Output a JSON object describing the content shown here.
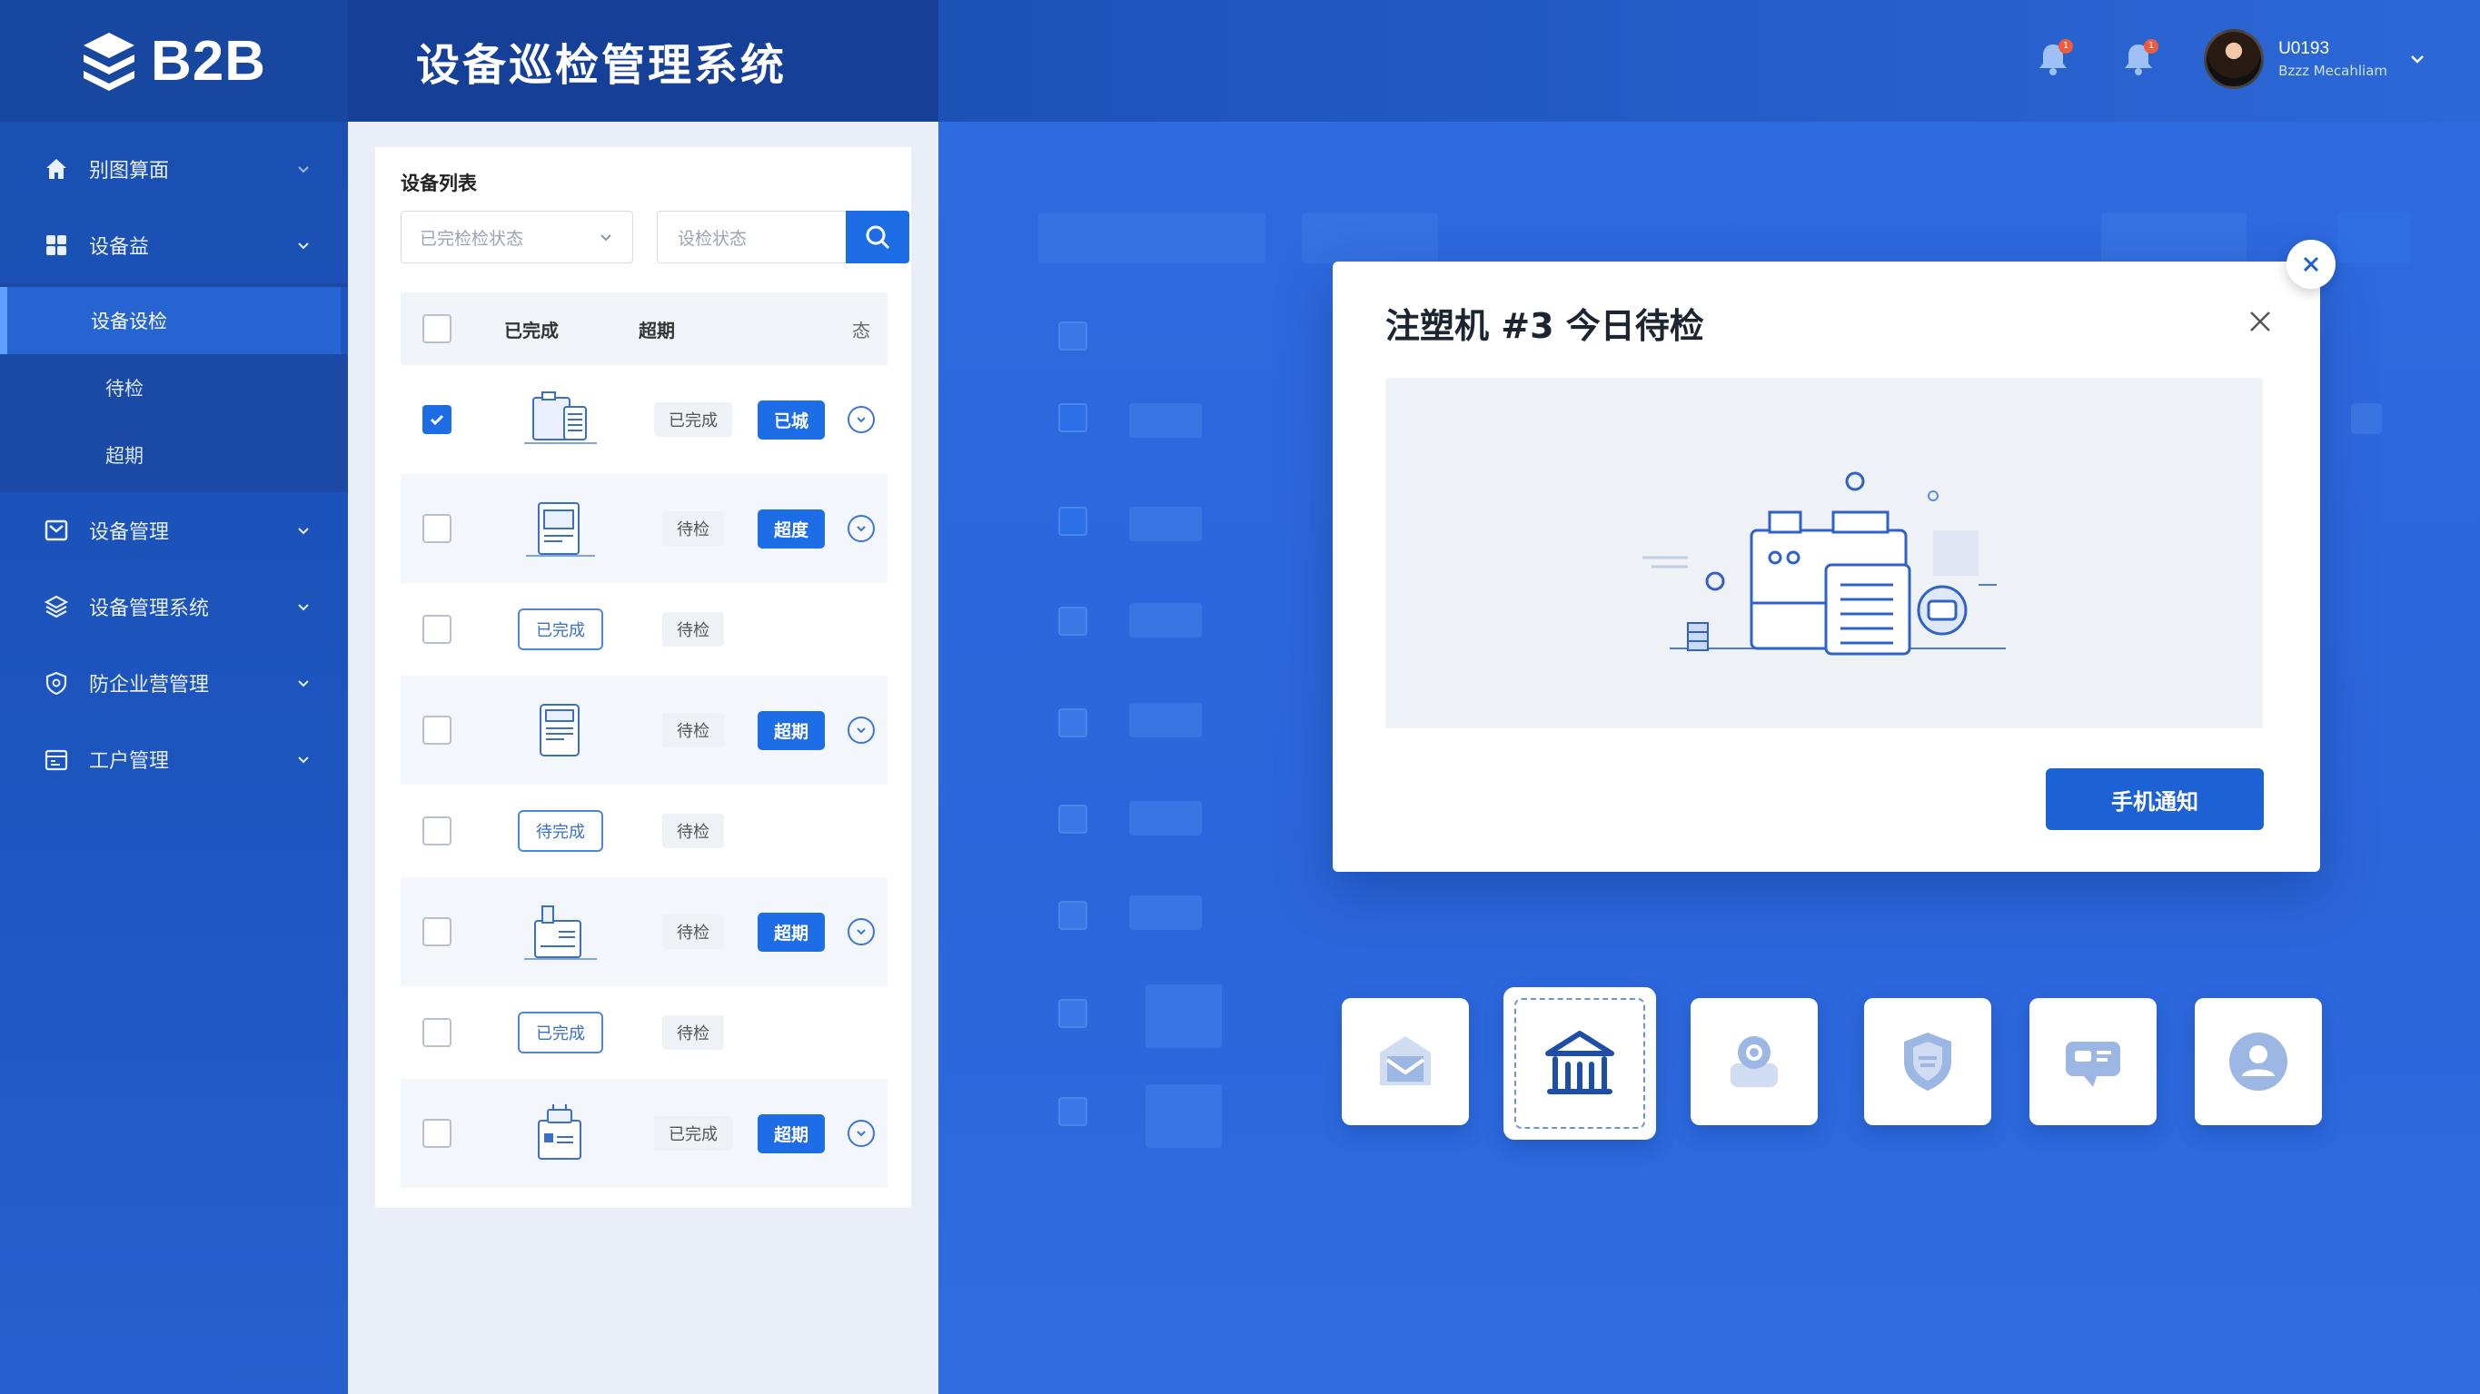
{
  "brand": {
    "name": "B2B"
  },
  "app": {
    "title": "设备巡检管理系统"
  },
  "sidebar": {
    "items": [
      {
        "label": "别图算面",
        "icon": "home-icon"
      },
      {
        "label": "设备益",
        "icon": "grid-icon"
      },
      {
        "label": "设备管理",
        "icon": "device-icon"
      },
      {
        "label": "设备管理系统",
        "icon": "stack-icon"
      },
      {
        "label": "防企业营管理",
        "icon": "shield-icon"
      },
      {
        "label": "工户管理",
        "icon": "calendar-icon"
      }
    ],
    "subitems": [
      {
        "label": "设备设检"
      },
      {
        "label": "待检"
      },
      {
        "label": "超期"
      }
    ]
  },
  "header": {
    "user_name": "U0193",
    "user_role": "Bzzz Mecahliam",
    "badge1": "1",
    "badge2": "1"
  },
  "list": {
    "title": "设备列表",
    "filter_placeholder": "已完检检状态",
    "search_placeholder": "设检状态",
    "columns": [
      "已完成",
      "超期",
      "态"
    ],
    "rows": [
      {
        "status": "已完成",
        "tag": "已城",
        "checked": true
      },
      {
        "status": "待检",
        "tag": "超度"
      },
      {
        "outline": "已完成",
        "status": "待检"
      },
      {
        "status": "待检",
        "tag": "超期"
      },
      {
        "outline": "待完成",
        "status": "待检"
      },
      {
        "status": "待检",
        "tag": "超期"
      },
      {
        "outline": "已完成",
        "status": "待检"
      },
      {
        "status": "已完成",
        "tag": "超期"
      }
    ]
  },
  "modal": {
    "title": "注塑机 #3 今日待检",
    "button": "手机通知"
  },
  "tiles": [
    {
      "icon": "mail-icon"
    },
    {
      "icon": "store-icon"
    },
    {
      "icon": "location-icon"
    },
    {
      "icon": "shield-badge-icon"
    },
    {
      "icon": "chat-icon"
    },
    {
      "icon": "user-icon"
    }
  ],
  "colors": {
    "primary": "#1d6ee6",
    "sidebar": "#1a4fb0",
    "background": "#2f6ee0"
  }
}
